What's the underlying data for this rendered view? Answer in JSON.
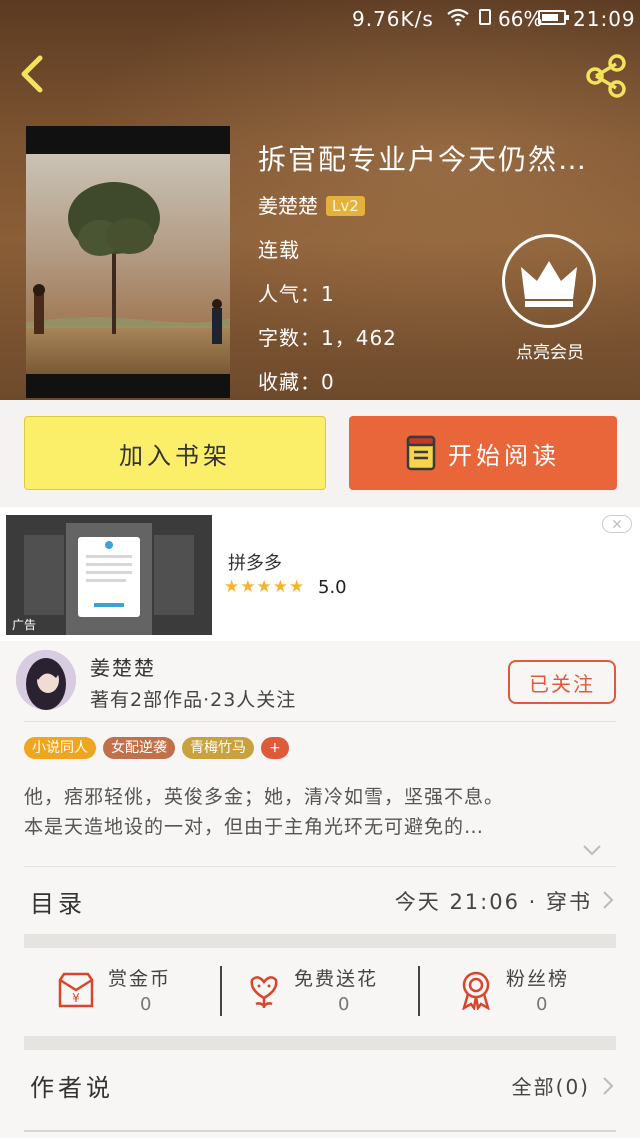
{
  "status_bar": {
    "speed": "9.76K/s",
    "battery": "66%",
    "time": "21:09"
  },
  "header": {
    "back_icon": "chevron-left-icon",
    "share_icon": "share-icon"
  },
  "book": {
    "title": "拆官配专业户今天仍然…",
    "author": "姜楚楚",
    "level": "Lv2",
    "status": "连载",
    "popularity": "人气：1",
    "word_count": "字数：1，462",
    "favorites": "收藏：0",
    "vip_label": "点亮会员"
  },
  "actions": {
    "add_shelf": "加入书架",
    "start_reading": "开始阅读"
  },
  "ad": {
    "tag": "广告",
    "app_name": "拼多多",
    "stars": "★★★★★",
    "rating": "5.0"
  },
  "author": {
    "name": "姜楚楚",
    "meta": "著有2部作品·23人关注",
    "follow_label": "已关注"
  },
  "tags": [
    {
      "label": "小说同人",
      "color": "#f0a51e"
    },
    {
      "label": "女配逆袭",
      "color": "#c1714a"
    },
    {
      "label": "青梅竹马",
      "color": "#caa23d"
    },
    {
      "label": "+",
      "color": "#e05a3a"
    }
  ],
  "synopsis": {
    "line1": "他，痞邪轻佻，英俊多金；她，清冷如雪，坚强不息。",
    "line2": "本是天造地设的一对，但由于主角光环无可避免的…"
  },
  "toc": {
    "label": "目录",
    "latest": "今天 21:06 · 穿书"
  },
  "stats": [
    {
      "label": "赏金币",
      "count": "0",
      "icon": "red-envelope-icon"
    },
    {
      "label": "免费送花",
      "count": "0",
      "icon": "flower-icon"
    },
    {
      "label": "粉丝榜",
      "count": "0",
      "icon": "medal-icon"
    }
  ],
  "author_says": {
    "label": "作者说",
    "all": "全部(0)"
  },
  "colors": {
    "accent": "#e8663a",
    "shelf_button": "#fbef6a",
    "follow": "#e05a3a"
  }
}
